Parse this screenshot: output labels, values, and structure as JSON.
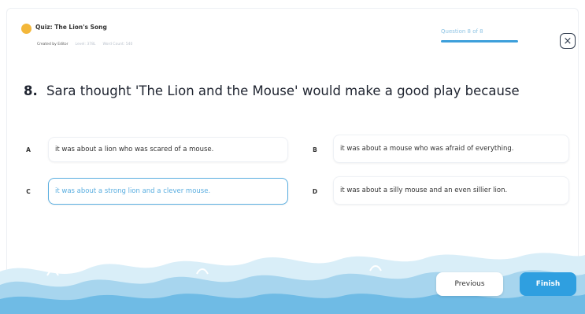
{
  "header": {
    "quiz_title": "Quiz: The Lion's Song",
    "meta": [
      "Created by Editor",
      "Level: 378L",
      "Word Count: 540"
    ],
    "question_counter": "Question 8 of 8"
  },
  "question": {
    "number": "8.",
    "text": "Sara thought 'The Lion and the Mouse' would make a good play because"
  },
  "options": [
    {
      "letter": "A",
      "text": "it was about a lion who was scared of a mouse."
    },
    {
      "letter": "B",
      "text": "it was about a mouse who was afraid of everything."
    },
    {
      "letter": "C",
      "text": "it was about a strong lion and a clever mouse."
    },
    {
      "letter": "D",
      "text": "it was about a silly mouse and an even sillier lion."
    }
  ],
  "selected_option": "C",
  "footer": {
    "previous_label": "Previous",
    "finish_label": "Finish"
  },
  "colors": {
    "accent": "#2f9fe0",
    "selected": "#5aaee0",
    "quiz_dot": "#f3b73a"
  },
  "icons": {
    "close": "close-icon",
    "quiz": "quiz-dot-icon"
  }
}
